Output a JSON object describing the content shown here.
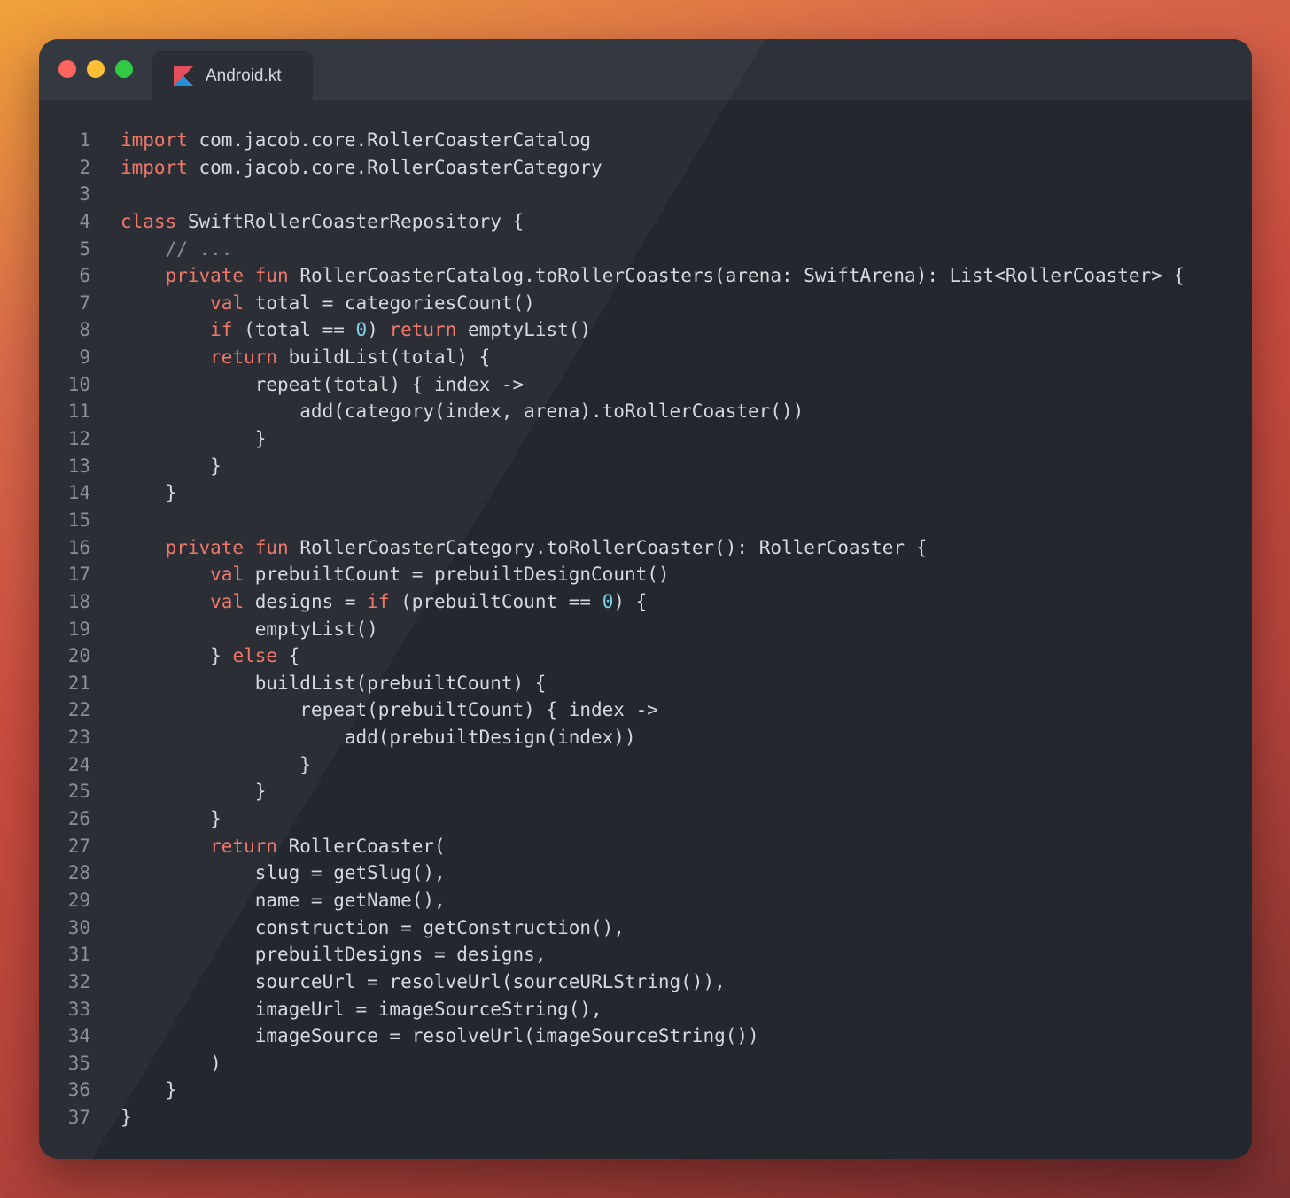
{
  "window": {
    "controls": [
      "close",
      "minimize",
      "maximize"
    ],
    "tab": {
      "label": "Android.kt",
      "icon": "kotlin-icon"
    }
  },
  "colors": {
    "keyword": "#f0786b",
    "number": "#7fd0e8",
    "text": "#d6d9dd",
    "line_number": "#8b919a",
    "editor_bg": "#23272e",
    "titlebar_bg": "#2d3139"
  },
  "code_lines": [
    [
      {
        "t": "import",
        "k": "kw"
      },
      {
        "t": " com.jacob.core.RollerCoasterCatalog"
      }
    ],
    [
      {
        "t": "import",
        "k": "kw"
      },
      {
        "t": " com.jacob.core.RollerCoasterCategory"
      }
    ],
    [],
    [
      {
        "t": "class",
        "k": "kw"
      },
      {
        "t": " SwiftRollerCoasterRepository {"
      }
    ],
    [
      {
        "t": "    "
      },
      {
        "t": "// ...",
        "k": "cm"
      }
    ],
    [
      {
        "t": "    "
      },
      {
        "t": "private",
        "k": "kw"
      },
      {
        "t": " "
      },
      {
        "t": "fun",
        "k": "kw"
      },
      {
        "t": " RollerCoasterCatalog.toRollerCoasters(arena: SwiftArena): List<RollerCoaster> {"
      }
    ],
    [
      {
        "t": "        "
      },
      {
        "t": "val",
        "k": "kw"
      },
      {
        "t": " total = categoriesCount()"
      }
    ],
    [
      {
        "t": "        "
      },
      {
        "t": "if",
        "k": "kw"
      },
      {
        "t": " (total == "
      },
      {
        "t": "0",
        "k": "num"
      },
      {
        "t": ") "
      },
      {
        "t": "return",
        "k": "kw"
      },
      {
        "t": " emptyList()"
      }
    ],
    [
      {
        "t": "        "
      },
      {
        "t": "return",
        "k": "kw"
      },
      {
        "t": " buildList(total) {"
      }
    ],
    [
      {
        "t": "            repeat(total) { index ->"
      }
    ],
    [
      {
        "t": "                add(category(index, arena).toRollerCoaster())"
      }
    ],
    [
      {
        "t": "            }"
      }
    ],
    [
      {
        "t": "        }"
      }
    ],
    [
      {
        "t": "    }"
      }
    ],
    [],
    [
      {
        "t": "    "
      },
      {
        "t": "private",
        "k": "kw"
      },
      {
        "t": " "
      },
      {
        "t": "fun",
        "k": "kw"
      },
      {
        "t": " RollerCoasterCategory.toRollerCoaster(): RollerCoaster {"
      }
    ],
    [
      {
        "t": "        "
      },
      {
        "t": "val",
        "k": "kw"
      },
      {
        "t": " prebuiltCount = prebuiltDesignCount()"
      }
    ],
    [
      {
        "t": "        "
      },
      {
        "t": "val",
        "k": "kw"
      },
      {
        "t": " designs = "
      },
      {
        "t": "if",
        "k": "kw"
      },
      {
        "t": " (prebuiltCount == "
      },
      {
        "t": "0",
        "k": "num"
      },
      {
        "t": ") {"
      }
    ],
    [
      {
        "t": "            emptyList()"
      }
    ],
    [
      {
        "t": "        } "
      },
      {
        "t": "else",
        "k": "kw"
      },
      {
        "t": " {"
      }
    ],
    [
      {
        "t": "            buildList(prebuiltCount) {"
      }
    ],
    [
      {
        "t": "                repeat(prebuiltCount) { index ->"
      }
    ],
    [
      {
        "t": "                    add(prebuiltDesign(index))"
      }
    ],
    [
      {
        "t": "                }"
      }
    ],
    [
      {
        "t": "            }"
      }
    ],
    [
      {
        "t": "        }"
      }
    ],
    [
      {
        "t": "        "
      },
      {
        "t": "return",
        "k": "kw"
      },
      {
        "t": " RollerCoaster("
      }
    ],
    [
      {
        "t": "            slug = getSlug(),"
      }
    ],
    [
      {
        "t": "            name = getName(),"
      }
    ],
    [
      {
        "t": "            construction = getConstruction(),"
      }
    ],
    [
      {
        "t": "            prebuiltDesigns = designs,"
      }
    ],
    [
      {
        "t": "            sourceUrl = resolveUrl(sourceURLString()),"
      }
    ],
    [
      {
        "t": "            imageUrl = imageSourceString(),"
      }
    ],
    [
      {
        "t": "            imageSource = resolveUrl(imageSourceString())"
      }
    ],
    [
      {
        "t": "        )"
      }
    ],
    [
      {
        "t": "    }"
      }
    ],
    [
      {
        "t": "}"
      }
    ]
  ]
}
